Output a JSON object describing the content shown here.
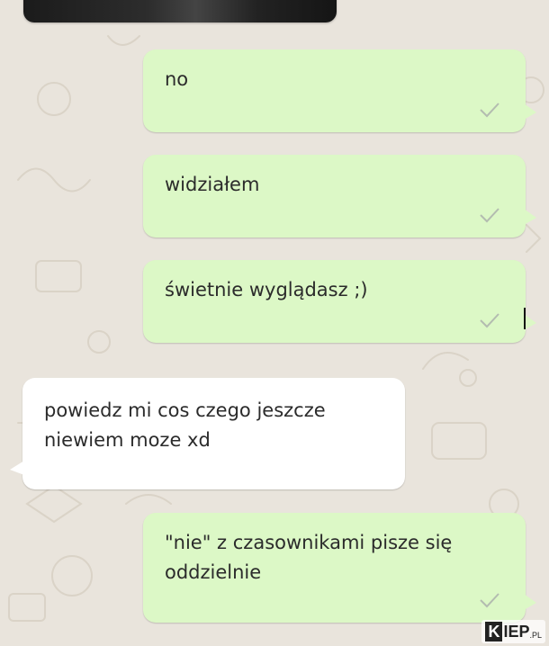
{
  "messages": [
    {
      "direction": "outgoing",
      "text": "no",
      "status": "sent-check-icon"
    },
    {
      "direction": "outgoing",
      "text": "widziałem",
      "status": "sent-check-icon"
    },
    {
      "direction": "outgoing",
      "text": "świetnie wyglądasz ;)",
      "status": "sent-check-icon"
    },
    {
      "direction": "incoming",
      "lines": [
        "powiedz mi cos czego jeszcze",
        "niewiem moze xd"
      ]
    },
    {
      "direction": "outgoing",
      "lines": [
        "\"nie\" z czasownikami pisze się",
        "oddzielnie"
      ],
      "status": "sent-check-icon"
    }
  ],
  "watermark": {
    "brand_k": "K",
    "brand_rest": "IEP",
    "brand_tld": ".PL"
  },
  "colors": {
    "outgoing_bubble": "#dcf8c6",
    "incoming_bubble": "#ffffff",
    "background": "#e9e4dc",
    "check": "#b3bcb0"
  }
}
